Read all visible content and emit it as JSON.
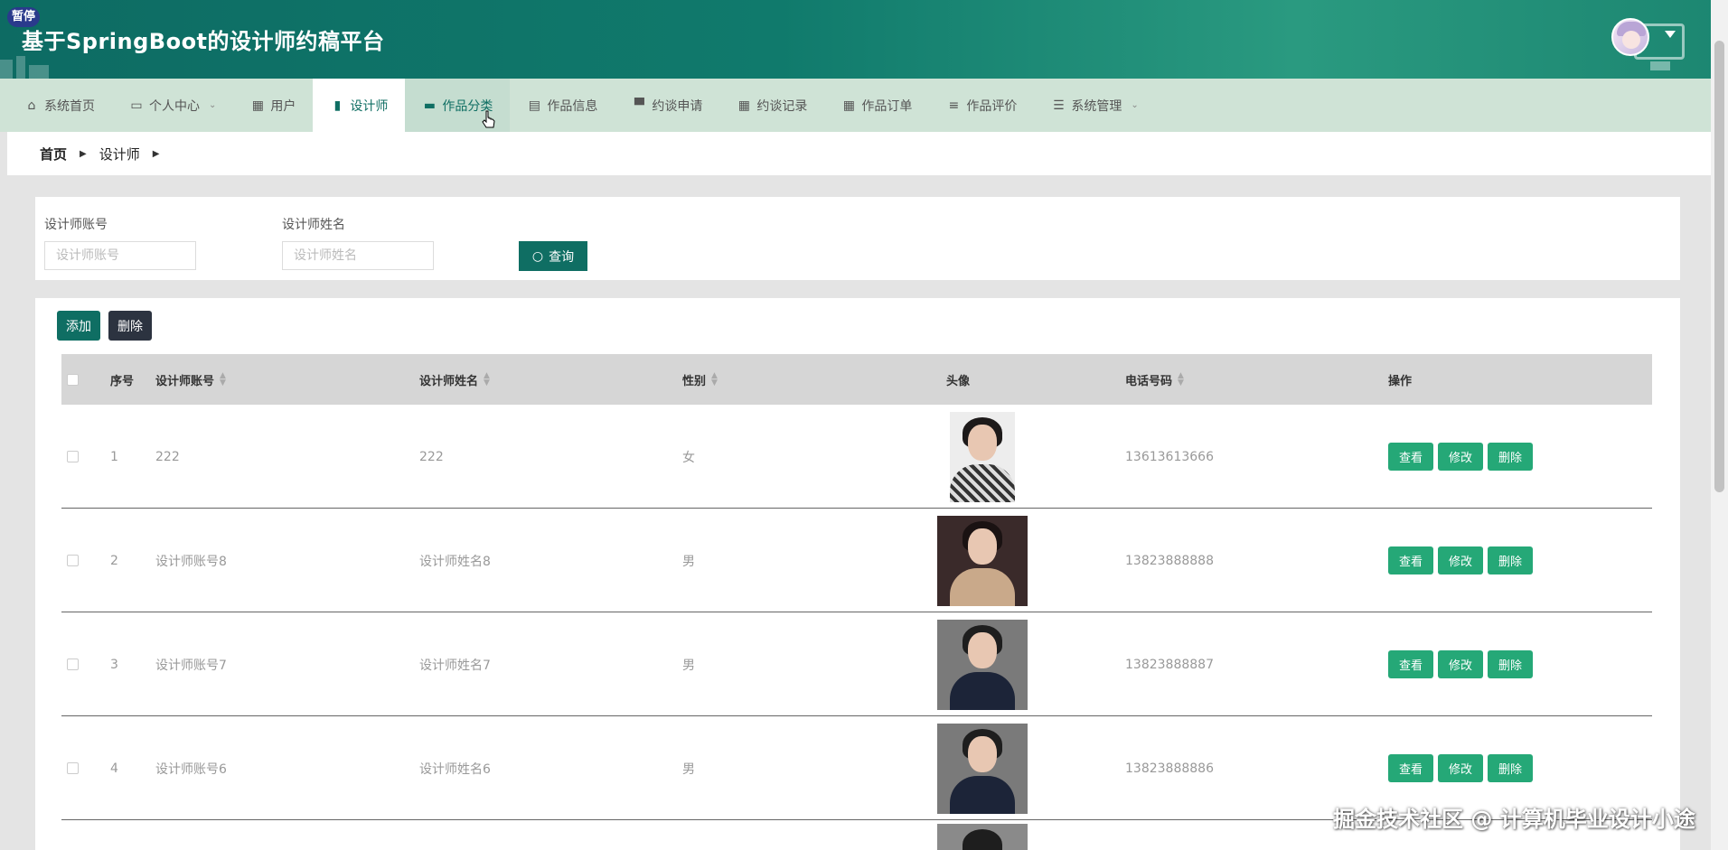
{
  "header": {
    "title": "基于SpringBoot的设计师约稿平台",
    "pause_badge": "暂停"
  },
  "nav": {
    "items": [
      {
        "label": "系统首页",
        "icon": "home-icon",
        "glyph": "⌂"
      },
      {
        "label": "个人中心",
        "icon": "calendar-icon",
        "glyph": "▭",
        "dropdown": true
      },
      {
        "label": "用户",
        "icon": "grid-icon",
        "glyph": "▦"
      },
      {
        "label": "设计师",
        "icon": "bar-chart-icon",
        "glyph": "▮",
        "active": true
      },
      {
        "label": "作品分类",
        "icon": "briefcase-icon",
        "glyph": "▬",
        "hover": true
      },
      {
        "label": "作品信息",
        "icon": "clipboard-icon",
        "glyph": "▤"
      },
      {
        "label": "约谈申请",
        "icon": "chat-icon",
        "glyph": "▀"
      },
      {
        "label": "约谈记录",
        "icon": "grid-icon",
        "glyph": "▦"
      },
      {
        "label": "作品订单",
        "icon": "grid-icon",
        "glyph": "▦"
      },
      {
        "label": "作品评价",
        "icon": "list-icon",
        "glyph": "≡"
      },
      {
        "label": "系统管理",
        "icon": "sliders-icon",
        "glyph": "☰",
        "dropdown": true
      }
    ]
  },
  "breadcrumb": {
    "home": "首页",
    "current": "设计师"
  },
  "search": {
    "account_label": "设计师账号",
    "account_placeholder": "设计师账号",
    "name_label": "设计师姓名",
    "name_placeholder": "设计师姓名",
    "query_button": "查询"
  },
  "toolbar": {
    "add_label": "添加",
    "delete_label": "删除"
  },
  "table": {
    "columns": {
      "index": "序号",
      "account": "设计师账号",
      "name": "设计师姓名",
      "gender": "性别",
      "avatar": "头像",
      "phone": "电话号码",
      "actions": "操作"
    },
    "rows": [
      {
        "index": "1",
        "account": "222",
        "name": "222",
        "gender": "女",
        "phone": "13613613666",
        "photo": "woman-checkered"
      },
      {
        "index": "2",
        "account": "设计师账号8",
        "name": "设计师姓名8",
        "gender": "男",
        "phone": "13823888888",
        "photo": "woman-beige"
      },
      {
        "index": "3",
        "account": "设计师账号7",
        "name": "设计师姓名7",
        "gender": "男",
        "phone": "13823888887",
        "photo": "man-suit"
      },
      {
        "index": "4",
        "account": "设计师账号6",
        "name": "设计师姓名6",
        "gender": "男",
        "phone": "13823888886",
        "photo": "man-suit"
      }
    ],
    "row_actions": {
      "view": "查看",
      "edit": "修改",
      "delete": "删除"
    }
  },
  "watermark": "掘金技术社区 @ 计算机毕业设计小途",
  "colors": {
    "primary": "#0f6e63",
    "action_green": "#25a877",
    "nav_bg": "#cfe3d6",
    "dark_button": "#2c3340"
  }
}
